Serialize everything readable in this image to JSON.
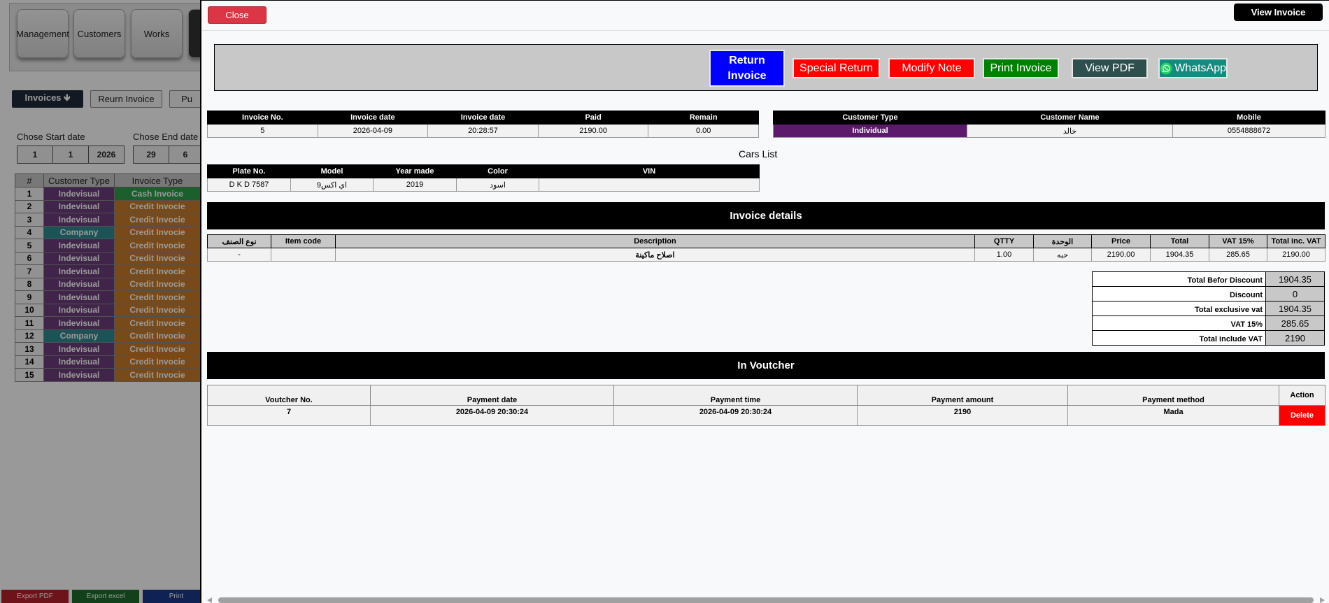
{
  "background": {
    "nav": [
      "Management",
      "Customers",
      "Works"
    ],
    "tabs": {
      "invoices": "Invoices 🡻",
      "return": "Reurn Invoice",
      "pu": "Pu"
    },
    "start_label": "Chose Start date",
    "end_label": "Chose End date",
    "start_date": [
      "1",
      "1",
      "2026"
    ],
    "end_date": [
      "29",
      "6"
    ],
    "table_headers": [
      "#",
      "Customer Type",
      "Invoice Type"
    ],
    "rows": [
      {
        "n": "1",
        "ct": "Indevisual",
        "it": "Cash Invoice"
      },
      {
        "n": "2",
        "ct": "Indevisual",
        "it": "Credit Invocie"
      },
      {
        "n": "3",
        "ct": "Indevisual",
        "it": "Credit Invocie"
      },
      {
        "n": "4",
        "ct": "Company",
        "it": "Credit Invocie"
      },
      {
        "n": "5",
        "ct": "Indevisual",
        "it": "Credit Invocie"
      },
      {
        "n": "6",
        "ct": "Indevisual",
        "it": "Credit Invocie"
      },
      {
        "n": "7",
        "ct": "Indevisual",
        "it": "Credit Invocie"
      },
      {
        "n": "8",
        "ct": "Indevisual",
        "it": "Credit Invocie"
      },
      {
        "n": "9",
        "ct": "Indevisual",
        "it": "Credit Invocie"
      },
      {
        "n": "10",
        "ct": "Indevisual",
        "it": "Credit Invocie"
      },
      {
        "n": "11",
        "ct": "Indevisual",
        "it": "Credit Invocie"
      },
      {
        "n": "12",
        "ct": "Company",
        "it": "Credit Invocie"
      },
      {
        "n": "13",
        "ct": "Indevisual",
        "it": "Credit Invocie"
      },
      {
        "n": "14",
        "ct": "Indevisual",
        "it": "Credit Invocie"
      },
      {
        "n": "15",
        "ct": "Indevisual",
        "it": "Credit Invocie"
      }
    ],
    "bottom": {
      "export_pdf": "Export PDF",
      "export_excel": "Export excel",
      "print": "Print"
    }
  },
  "modal": {
    "close": "Close",
    "view_invoice": "View Invoice",
    "actions": {
      "return": "Return Invoice",
      "special_return": "Special Return",
      "modify_note": "Modify Note",
      "print_invoice": "Print Invoice",
      "view_pdf": "View PDF",
      "whatsapp": "WhatsApp"
    },
    "invoice_info": {
      "headers": [
        "Invoice No.",
        "Invoice date",
        "Invoice date",
        "Paid",
        "Remain"
      ],
      "values": [
        "5",
        "2026-04-09",
        "20:28:57",
        "2190.00",
        "0.00"
      ]
    },
    "customer_info": {
      "headers": [
        "Customer Type",
        "Customer Name",
        "Mobile"
      ],
      "values": [
        "Individual",
        "خالد",
        "0554888672"
      ]
    },
    "cars_title": "Cars List",
    "cars": {
      "headers": [
        "Plate No.",
        "Model",
        "Year made",
        "Color",
        "VIN"
      ],
      "values": [
        "D K D 7587",
        "اي اكس9",
        "2019",
        "اسود",
        ""
      ]
    },
    "details_title": "Invoice details",
    "details": {
      "headers": [
        "نوع الصنف",
        "Item code",
        "Description",
        "QTTY",
        "الوحدة",
        "Price",
        "Total",
        "VAT 15%",
        "Total inc. VAT"
      ],
      "values": [
        "-",
        "",
        "اصلاح ماكينة",
        "1.00",
        "حبه",
        "2190.00",
        "1904.35",
        "285.65",
        "2190.00"
      ]
    },
    "totals": [
      {
        "label": "Total Befor Discount",
        "value": "1904.35"
      },
      {
        "label": "Discount",
        "value": "0"
      },
      {
        "label": "Total exclusive vat",
        "value": "1904.35"
      },
      {
        "label": "VAT 15%",
        "value": "285.65"
      },
      {
        "label": "Total include VAT",
        "value": "2190"
      }
    ],
    "voucher_title": "In Voutcher",
    "voucher": {
      "headers": [
        "Voutcher No.",
        "Payment date",
        "Payment time",
        "Payment amount",
        "Payment method",
        "Action"
      ],
      "values": [
        "7",
        "2026-04-09 20:30:24",
        "2026-04-09 20:30:24",
        "2190",
        "Mada"
      ],
      "delete": "Delete"
    }
  }
}
